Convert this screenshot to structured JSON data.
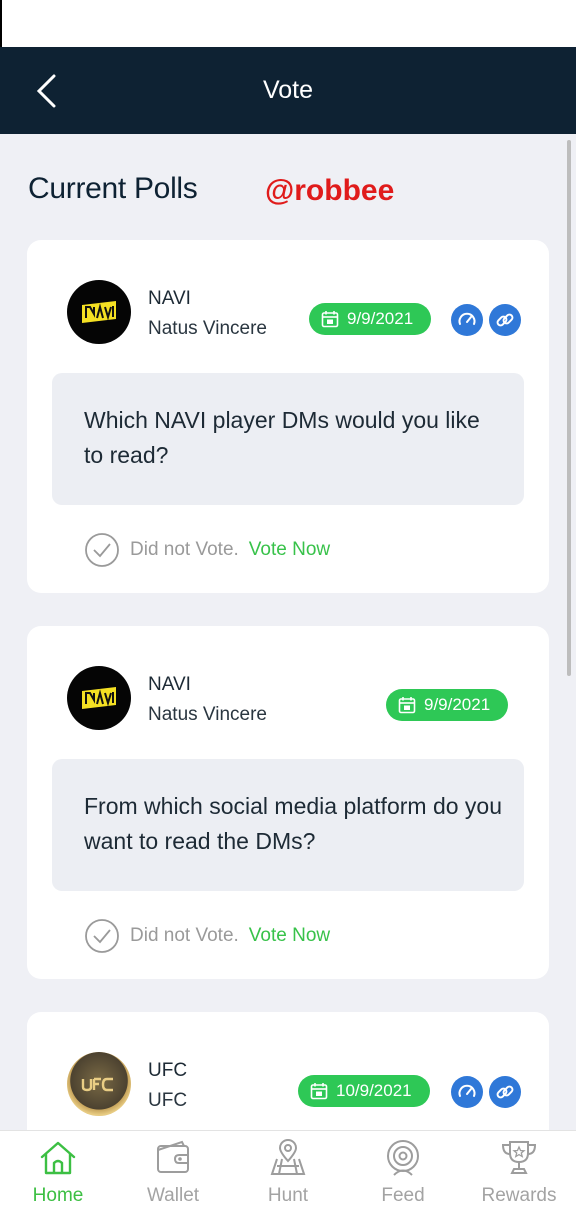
{
  "header": {
    "title": "Vote"
  },
  "section": {
    "title": "Current Polls",
    "watermark": "@robbee"
  },
  "polls": [
    {
      "org": "NAVI",
      "org_full": "Natus Vincere",
      "date": "9/9/2021",
      "question": "Which NAVI player DMs would you like to read?",
      "status": "Did not Vote.",
      "action": "Vote Now"
    },
    {
      "org": "NAVI",
      "org_full": "Natus Vincere",
      "date": "9/9/2021",
      "question": "From which social media platform do you want to read the DMs?",
      "status": "Did not Vote.",
      "action": "Vote Now"
    },
    {
      "org": "UFC",
      "org_full": "UFC",
      "date": "10/9/2021"
    }
  ],
  "nav": [
    {
      "label": "Home",
      "icon": "home-icon",
      "active": true
    },
    {
      "label": "Wallet",
      "icon": "wallet-icon"
    },
    {
      "label": "Hunt",
      "icon": "map-icon"
    },
    {
      "label": "Feed",
      "icon": "feed-icon"
    },
    {
      "label": "Rewards",
      "icon": "trophy-icon"
    }
  ],
  "colors": {
    "header_bg": "#0e2233",
    "accent_green": "#2ec856",
    "vote_green": "#38c24a",
    "link_blue": "#2f78d8",
    "watermark_red": "#e01b1b"
  }
}
